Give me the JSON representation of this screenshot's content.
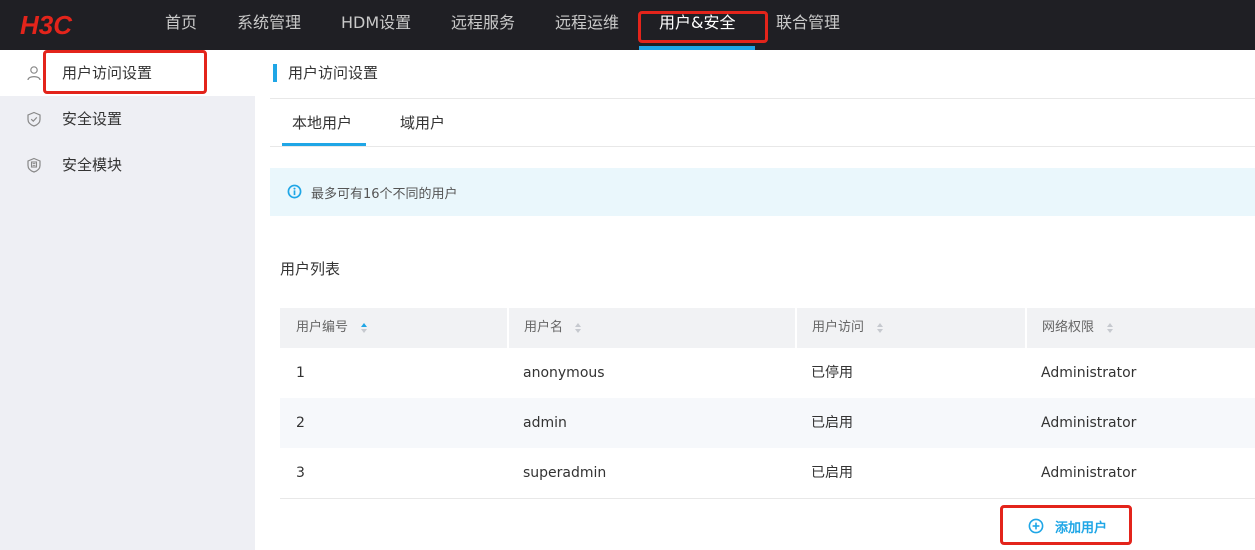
{
  "app": {
    "logo_text": "H3C"
  },
  "nav": {
    "items": [
      {
        "label": "首页"
      },
      {
        "label": "系统管理"
      },
      {
        "label": "HDM设置"
      },
      {
        "label": "远程服务"
      },
      {
        "label": "远程运维"
      },
      {
        "label": "用户&安全",
        "active": true
      },
      {
        "label": "联合管理"
      }
    ]
  },
  "sidebar": {
    "items": [
      {
        "label": "用户访问设置",
        "icon": "user-icon",
        "active": true
      },
      {
        "label": "安全设置",
        "icon": "shield-check-icon"
      },
      {
        "label": "安全模块",
        "icon": "security-module-icon"
      }
    ]
  },
  "page": {
    "title": "用户访问设置",
    "tabs": [
      {
        "label": "本地用户",
        "active": true
      },
      {
        "label": "域用户"
      }
    ],
    "info_text": "最多可有16个不同的用户",
    "section_title": "用户列表"
  },
  "table": {
    "columns": [
      "用户编号",
      "用户名",
      "用户访问",
      "网络权限"
    ],
    "rows": [
      [
        "1",
        "anonymous",
        "已停用",
        "Administrator"
      ],
      [
        "2",
        "admin",
        "已启用",
        "Administrator"
      ],
      [
        "3",
        "superadmin",
        "已启用",
        "Administrator"
      ]
    ]
  },
  "actions": {
    "add_user_label": "添加用户"
  },
  "colors": {
    "accent": "#1fa6e6",
    "brand_red": "#e3241b",
    "topbar": "#1f1f24",
    "sidebar_bg": "#eeeff4"
  }
}
